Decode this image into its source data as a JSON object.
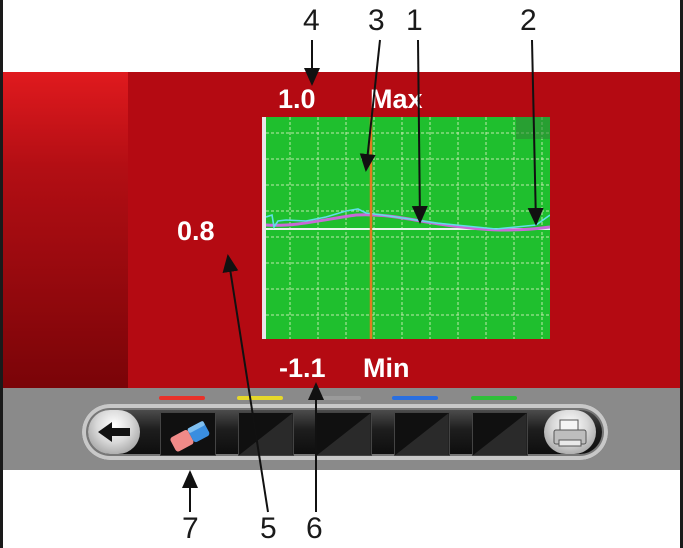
{
  "display": {
    "max_value": "1.0",
    "max_label": "Max",
    "min_value": "-1.1",
    "min_label": "Min",
    "current_value": "0.8"
  },
  "callouts": [
    "1",
    "2",
    "3",
    "4",
    "5",
    "6",
    "7"
  ],
  "toolbar": {
    "back_icon": "arrow-left-icon",
    "eraser_icon": "eraser-icon",
    "print_icon": "printer-icon",
    "channel_colors": [
      "#e8322a",
      "#e6d82a",
      "#9a9a9a",
      "#2a6fe0",
      "#2fbf3a"
    ]
  },
  "colors": {
    "background": "#b40a12",
    "graph": "#1fbf2e",
    "trace_magenta": "#c86ad8",
    "trace_cyan": "#5fe0e8",
    "cursor": "#e07a20"
  }
}
